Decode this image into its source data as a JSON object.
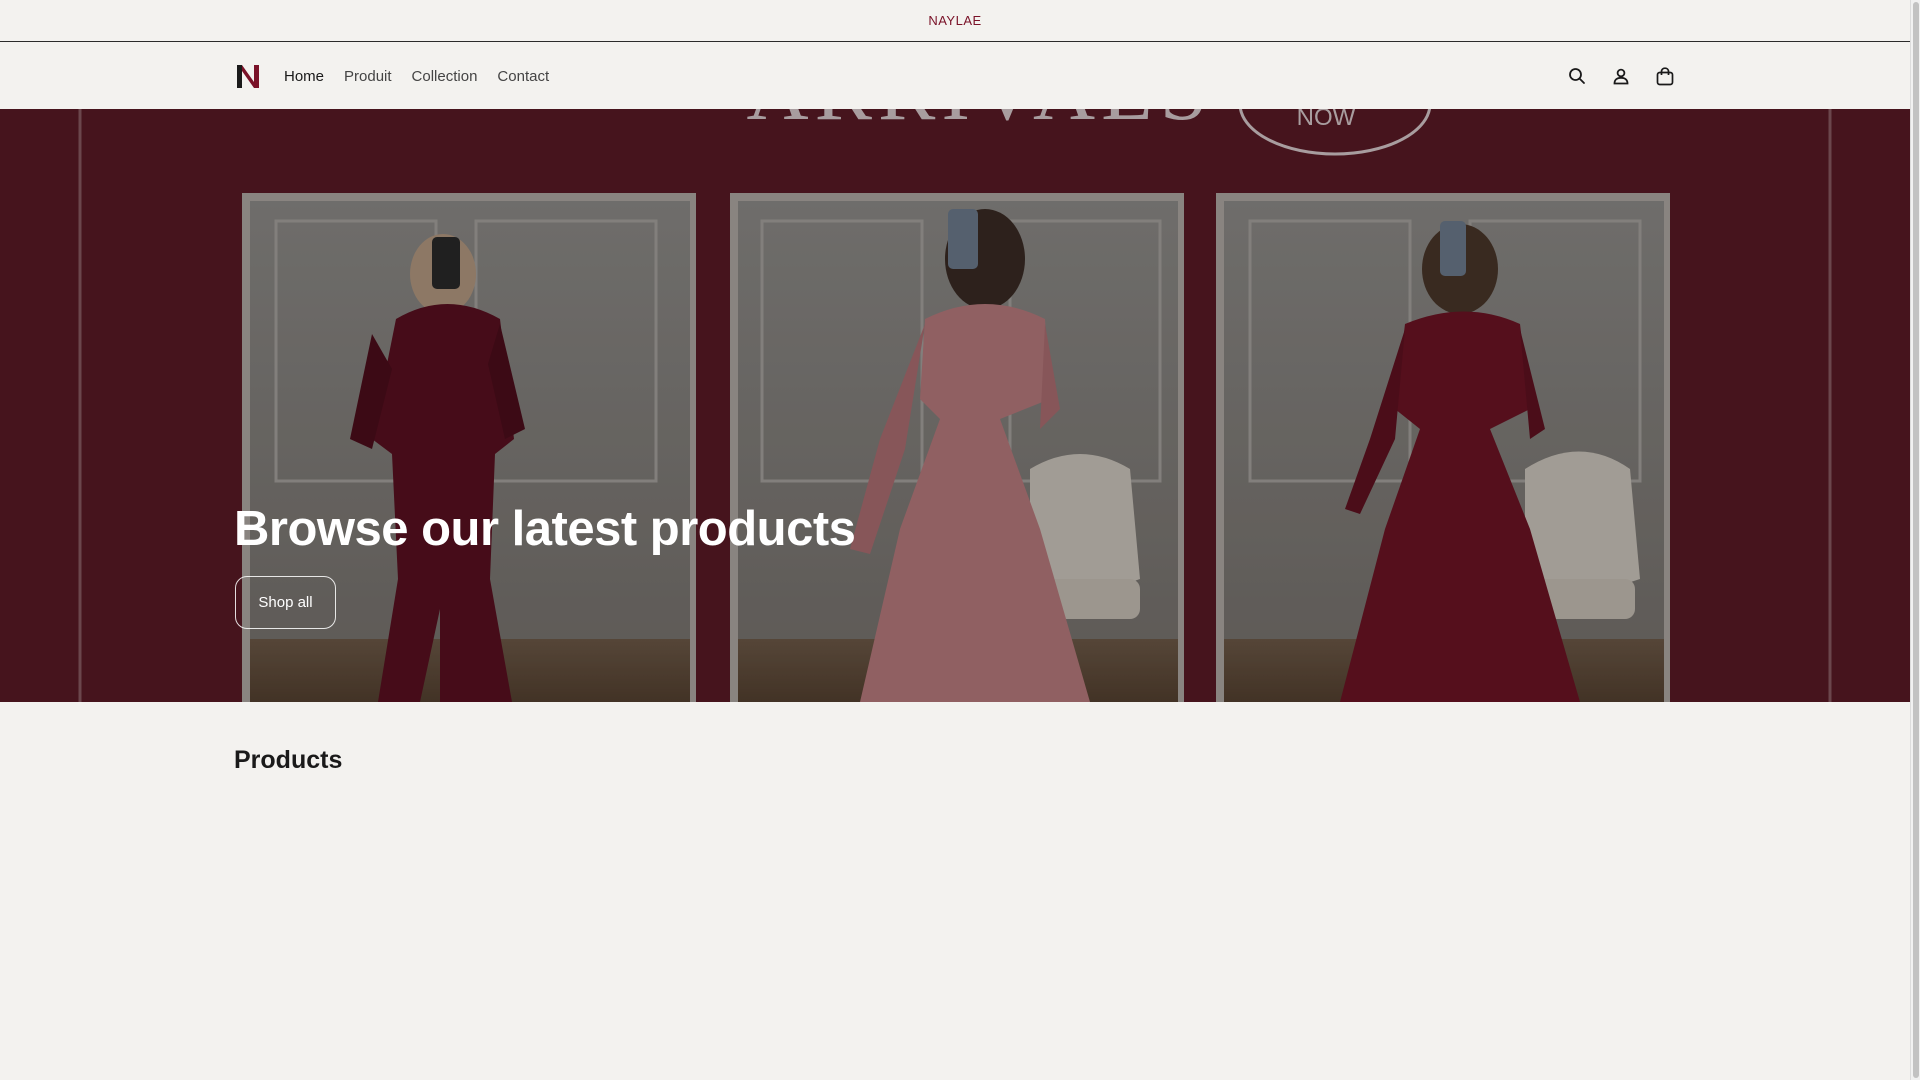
{
  "announcement": {
    "text": "NAYLAE"
  },
  "header": {
    "logo_icon": "naylae-logo",
    "nav": [
      {
        "label": "Home",
        "active": true
      },
      {
        "label": "Produit",
        "active": false
      },
      {
        "label": "Collection",
        "active": false
      },
      {
        "label": "Contact",
        "active": false
      }
    ],
    "icons": [
      "search-icon",
      "account-icon",
      "cart-icon"
    ]
  },
  "hero": {
    "banner_text_top": "ARRIVALS",
    "banner_badge": "NOW",
    "title": "Browse our latest products",
    "button_label": "Shop all"
  },
  "products": {
    "title": "Products"
  },
  "colors": {
    "brand": "#7a1228",
    "hero_bg": "#5a1a26",
    "page_bg": "#f3f2ef"
  }
}
